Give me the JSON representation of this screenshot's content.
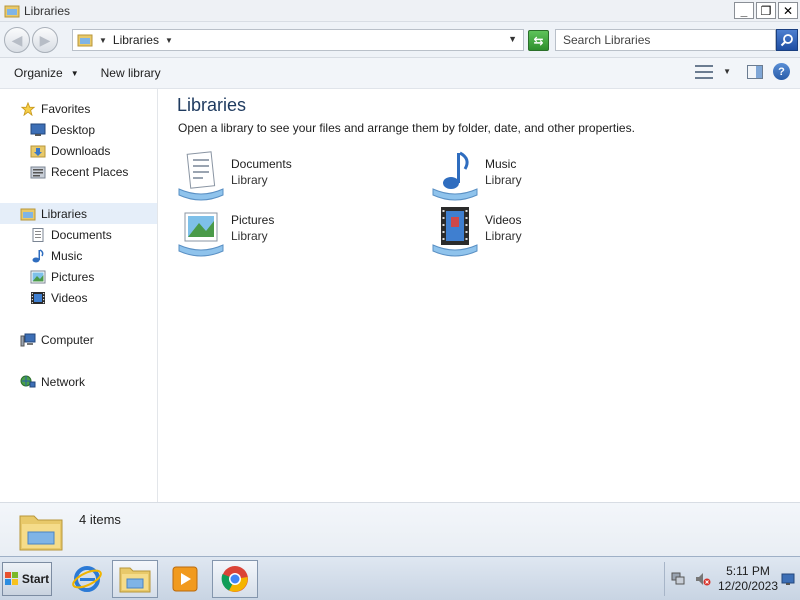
{
  "window": {
    "title": "Libraries",
    "controls": {
      "minimize": "_",
      "maximize": "❐",
      "close": "✕"
    }
  },
  "address": {
    "path": "Libraries",
    "search_placeholder": "Search Libraries"
  },
  "commands": {
    "organize": "Organize",
    "new_library": "New library"
  },
  "nav": {
    "favorites": "Favorites",
    "desktop": "Desktop",
    "downloads": "Downloads",
    "recent_places": "Recent Places",
    "libraries": "Libraries",
    "documents": "Documents",
    "music": "Music",
    "pictures": "Pictures",
    "videos": "Videos",
    "computer": "Computer",
    "network": "Network"
  },
  "content": {
    "title": "Libraries",
    "subtitle": "Open a library to see your files and arrange them by folder, date, and other properties.",
    "libraries": [
      {
        "name": "Documents",
        "type": "Library",
        "icon": "documents-library-icon"
      },
      {
        "name": "Music",
        "type": "Library",
        "icon": "music-library-icon"
      },
      {
        "name": "Pictures",
        "type": "Library",
        "icon": "pictures-library-icon"
      },
      {
        "name": "Videos",
        "type": "Library",
        "icon": "videos-library-icon"
      }
    ]
  },
  "details": {
    "count": "4 items"
  },
  "taskbar": {
    "start": "Start",
    "time": "5:11 PM",
    "date": "12/20/2023"
  },
  "colors": {
    "title_blue": "#1e3a5f",
    "selection": "#e5eef9",
    "taskbar": "#c8d4e3"
  }
}
